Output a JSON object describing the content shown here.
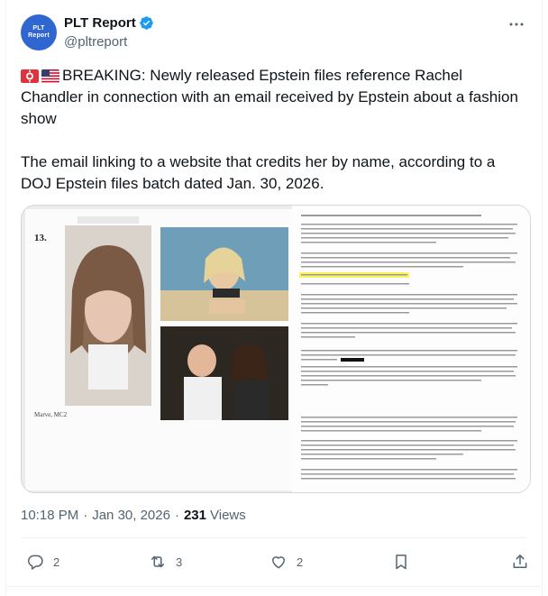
{
  "author": {
    "display_name": "PLT Report",
    "handle": "@pltreport",
    "avatar_text": "PLT Report",
    "verified": true
  },
  "tweet": {
    "text": "BREAKING: Newly released Epstein files reference Rachel Chandler in connection with an email received by Epstein about a fashion show\n\nThe email linking to a website that credits her by name, according to a DOJ Epstein files batch dated Jan. 30, 2026."
  },
  "media": {
    "page_number": "13.",
    "caption": "Marve, MC2"
  },
  "meta": {
    "time": "10:18 PM",
    "date": "Jan 30, 2026",
    "views_count": "231",
    "views_label": "Views",
    "separator": "·"
  },
  "actions": {
    "replies": "2",
    "reposts": "3",
    "likes": "2"
  },
  "icons": [
    "verified-badge-icon",
    "more-icon",
    "siren-emoji-icon",
    "us-flag-emoji-icon",
    "reply-icon",
    "repost-icon",
    "like-icon",
    "bookmark-icon",
    "share-icon"
  ],
  "colors": {
    "verified": "#1d9bf0",
    "secondary_text": "#536471",
    "primary_text": "#0f1419",
    "highlight": "#fff35c"
  }
}
